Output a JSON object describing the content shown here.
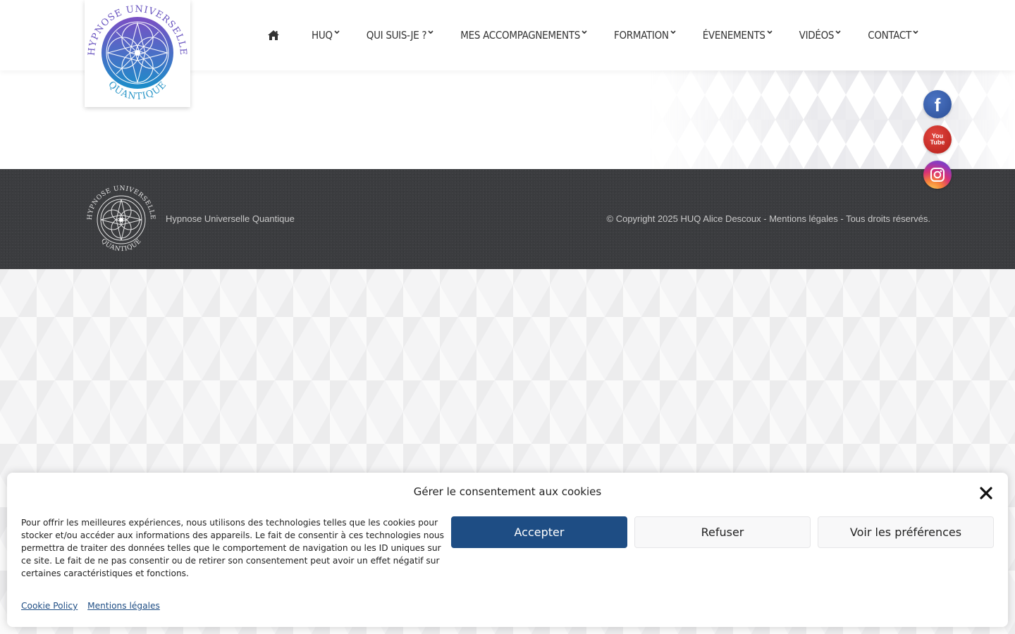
{
  "site": {
    "logo_text_top": "HYPNOSE UNIVERSELLE",
    "logo_text_bottom": "QUANTIQUE"
  },
  "nav": {
    "home_icon": "home-icon",
    "items": [
      {
        "label": "HUQ"
      },
      {
        "label": "QUI SUIS-JE ?"
      },
      {
        "label": "MES ACCOMPAGNEMENTS"
      },
      {
        "label": "FORMATION"
      },
      {
        "label": "ÉVENEMENTS"
      },
      {
        "label": "VIDÉOS"
      },
      {
        "label": "CONTACT"
      }
    ]
  },
  "social": {
    "facebook_label": "f",
    "youtube_label_1": "You",
    "youtube_label_2": "Tube"
  },
  "footer": {
    "site_name": "Hypnose Universelle Quantique",
    "copyright": "© Copyright 2025 HUQ Alice Descoux - Mentions légales - Tous droits réservés."
  },
  "cookie": {
    "title": "Gérer le consentement aux cookies",
    "text": "Pour offrir les meilleures expériences, nous utilisons des technologies telles que les cookies pour stocker et/ou accéder aux informations des appareils. Le fait de consentir à ces technologies nous permettra de traiter des données telles que le comportement de navigation ou les ID uniques sur ce site. Le fait de ne pas consentir ou de retirer son consentement peut avoir un effet négatif sur certaines caractéristiques et fonctions.",
    "accept": "Accepter",
    "refuse": "Refuser",
    "preferences": "Voir les préférences",
    "link_policy": "Cookie Policy",
    "link_legal": "Mentions légales"
  },
  "colors": {
    "accent": "#1e4d84",
    "footer_bg": "#3b3c3f",
    "logo_purple": "#7b4fc4",
    "logo_blue": "#1a8ec9"
  }
}
